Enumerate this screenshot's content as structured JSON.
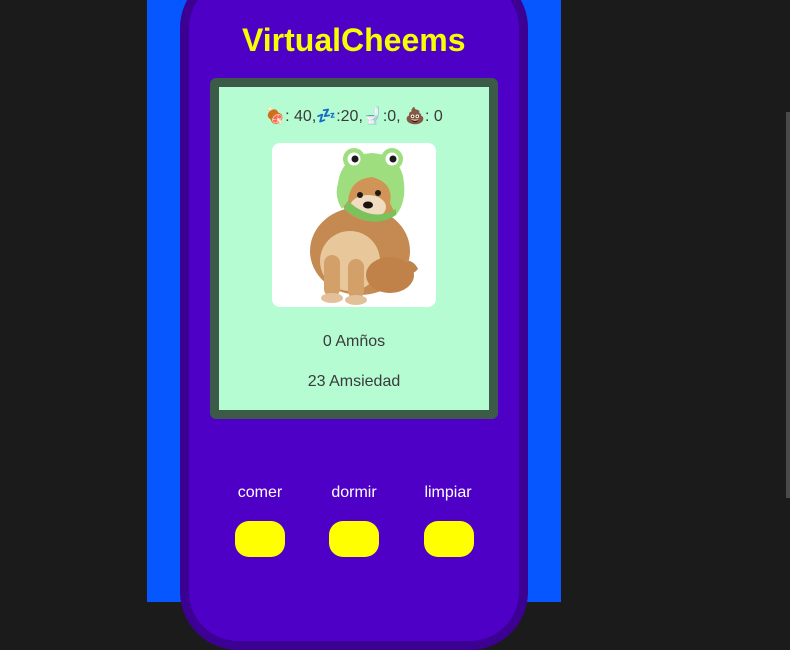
{
  "app": {
    "title": "VirtualCheems"
  },
  "stats": {
    "food_icon": "🍖",
    "food_text": ": 40,",
    "sleep_icon": "💤",
    "sleep_text": ":20,",
    "toilet_icon": "🚽",
    "toilet_text": ":0,",
    "poop_icon": "💩",
    "poop_text": ": 0"
  },
  "pet": {
    "image_icon": "cheems-frog-hat"
  },
  "status": {
    "age": "0 Amños",
    "anxiety": "23 Amsiedad"
  },
  "actions": [
    {
      "label": "comer"
    },
    {
      "label": "dormir"
    },
    {
      "label": "limpiar"
    }
  ],
  "colors": {
    "page_bg": "#1b1b1c",
    "column_bg": "#0657ff",
    "device_bg": "#4f00c7",
    "device_border": "#3c0092",
    "screen_bg": "#b5fcd3",
    "screen_border": "#3b5a48",
    "title": "#f5ff00",
    "button": "#ffff00"
  }
}
